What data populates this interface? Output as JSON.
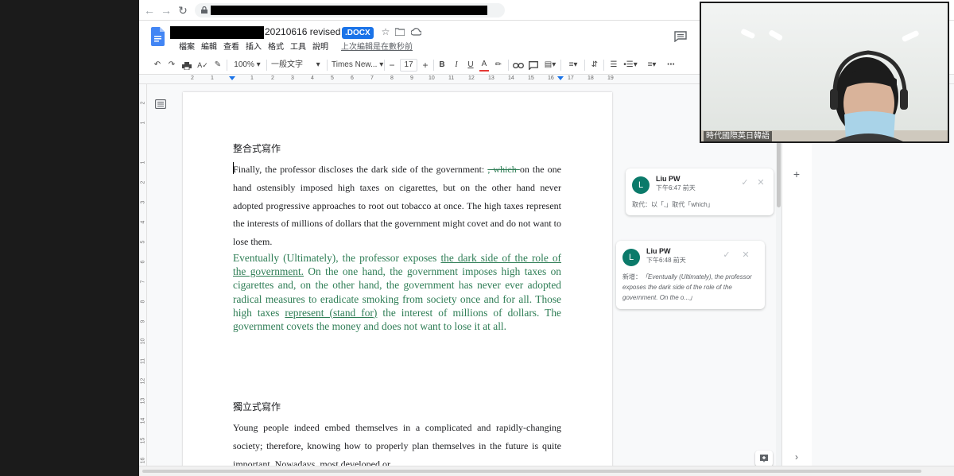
{
  "document": {
    "title_suffix": "20210616 revised",
    "file_badge": ".DOCX",
    "last_edit": "上次編輯是在數秒前"
  },
  "menu": [
    "檔案",
    "編輯",
    "查看",
    "插入",
    "格式",
    "工具",
    "說明"
  ],
  "toolbar": {
    "zoom": "100%",
    "style": "一般文字",
    "font": "Times New...",
    "font_size": "17",
    "bold": "B",
    "italic": "I",
    "underline": "U",
    "text_color": "A"
  },
  "ruler": {
    "labels": [
      "2",
      "1",
      "1",
      "2",
      "3",
      "4",
      "5",
      "6",
      "7",
      "8",
      "9",
      "10",
      "11",
      "12",
      "13",
      "14",
      "15",
      "16",
      "17",
      "18",
      "19"
    ]
  },
  "vertical_ruler": {
    "labels": [
      "2",
      "1",
      "1",
      "2",
      "3",
      "4",
      "5",
      "6",
      "7",
      "8",
      "9",
      "10",
      "11",
      "12",
      "13",
      "14",
      "15",
      "16"
    ]
  },
  "body": {
    "heading1": "整合式寫作",
    "para1_first": "F",
    "para1_text": "inally, the professor discloses the dark side of the government: ",
    "para1_deleted": ", which ",
    "para1_rest": "on the one hand ostensibly imposed high taxes on cigarettes, but on the other hand never adopted progressive approaches to root out tobacco at once. The high taxes represent the interests of millions of dollars that the government might covet and do not want to lose them.",
    "para2_start": "Eventually (Ultimately), the professor exposes ",
    "para2_u1": "the dark side of the role of the government.",
    "para2_mid": " On the one hand, the government imposes high taxes on cigarettes and, on the other hand, the government has never ever adopted radical measures to eradicate smoking from society once and for all. Those high taxes ",
    "para2_u2": "represent (stand for)",
    "para2_end": " the interest of millions of  dollars. The government covets the money and does not want to lose it at all.",
    "heading2": "獨立式寫作",
    "para3": "Young people indeed embed themselves in a complicated and rapidly-changing society; therefore, knowing how to properly plan themselves in the future is quite important. Nowadays, most developed or"
  },
  "comments": [
    {
      "avatar": "L",
      "author": "Liu PW",
      "time": "下午6:47 前天",
      "body": "取代：以「,」取代「which」"
    },
    {
      "avatar": "L",
      "author": "Liu PW",
      "time": "下午6:48 前天",
      "body_label": "新增：",
      "body_quote": "「Eventually (Ultimately), the professor exposes the dark side of the role of the government. On the o...」"
    }
  ],
  "webcam": {
    "label": "時代國際英日韓語"
  },
  "colors": {
    "accent": "#1a73e8",
    "suggestion_green": "#2e7d55",
    "avatar_teal": "#0b7a6a"
  }
}
